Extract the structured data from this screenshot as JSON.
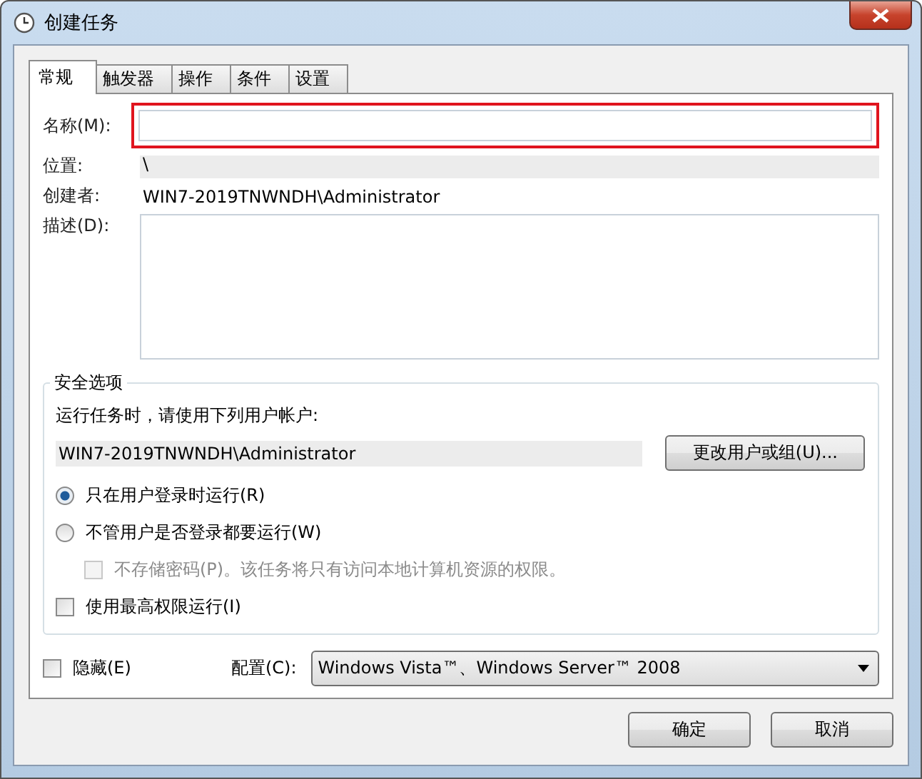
{
  "window": {
    "title": "创建任务"
  },
  "tabs": [
    {
      "label": "常规",
      "selected": true
    },
    {
      "label": "触发器",
      "selected": false
    },
    {
      "label": "操作",
      "selected": false
    },
    {
      "label": "条件",
      "selected": false
    },
    {
      "label": "设置",
      "selected": false
    }
  ],
  "general": {
    "name": {
      "label": "名称(M):",
      "highlighted": true
    },
    "location": {
      "label": "位置:",
      "value": "\\"
    },
    "author": {
      "label": "创建者:",
      "value": "WIN7-2019TNWNDH\\Administrator"
    },
    "description": {
      "label": "描述(D):"
    }
  },
  "security": {
    "title": "安全选项",
    "prompt": "运行任务时，请使用下列用户帐户:",
    "account": "WIN7-2019TNWNDH\\Administrator",
    "change_button": "更改用户或组(U)...",
    "options": [
      {
        "kind": "radio",
        "label": "只在用户登录时运行(R)",
        "selected": true,
        "disabled": false
      },
      {
        "kind": "radio",
        "label": "不管用户是否登录都要运行(W)",
        "selected": false,
        "disabled": false,
        "children": [
          {
            "kind": "checkbox",
            "label": "不存储密码(P)。该任务将只有访问本地计算机资源的权限。",
            "checked": false,
            "disabled": true
          }
        ]
      },
      {
        "kind": "checkbox",
        "label": "使用最高权限运行(I)",
        "checked": false,
        "disabled": false
      }
    ]
  },
  "hidden": {
    "label": "隐藏(E)",
    "checked": false
  },
  "configure": {
    "label": "配置(C):",
    "value": "Windows Vista™、Windows Server™ 2008"
  },
  "buttons": [
    "确定",
    "取消"
  ]
}
